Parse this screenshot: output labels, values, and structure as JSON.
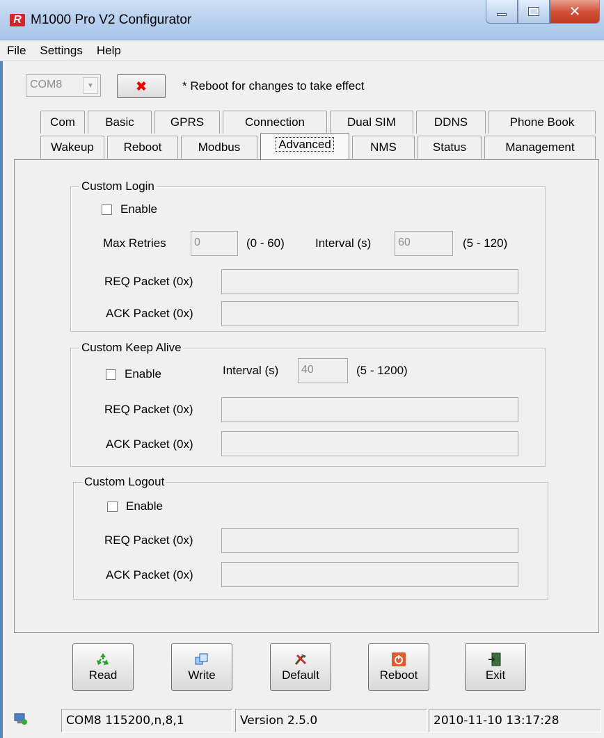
{
  "window": {
    "title": "M1000 Pro V2 Configurator",
    "icon_letter": "R"
  },
  "menu": [
    "File",
    "Settings",
    "Help"
  ],
  "toolbar": {
    "com_port": "COM8",
    "close_symbol": "✖",
    "note": "* Reboot for changes to take effect"
  },
  "tabs_row1": [
    "Com",
    "Basic",
    "GPRS",
    "Connection",
    "Dual SIM",
    "DDNS",
    "Phone Book"
  ],
  "tabs_row2": [
    "Wakeup",
    "Reboot",
    "Modbus",
    "Advanced",
    "NMS",
    "Status",
    "Management"
  ],
  "active_tab": "Advanced",
  "custom_login": {
    "title": "Custom Login",
    "enable_label": "Enable",
    "enabled": false,
    "max_retries_label": "Max Retries",
    "max_retries_value": "0",
    "max_retries_range": "(0 - 60)",
    "interval_label": "Interval (s)",
    "interval_value": "60",
    "interval_range": "(5 - 120)",
    "req_label": "REQ Packet (0x)",
    "req_value": "",
    "ack_label": "ACK Packet (0x)",
    "ack_value": ""
  },
  "custom_keepalive": {
    "title": "Custom Keep Alive",
    "enable_label": "Enable",
    "enabled": false,
    "interval_label": "Interval (s)",
    "interval_value": "40",
    "interval_range": "(5 - 1200)",
    "req_label": "REQ Packet (0x)",
    "req_value": "",
    "ack_label": "ACK Packet (0x)",
    "ack_value": ""
  },
  "custom_logout": {
    "title": "Custom Logout",
    "enable_label": "Enable",
    "enabled": false,
    "req_label": "REQ Packet (0x)",
    "req_value": "",
    "ack_label": "ACK Packet (0x)",
    "ack_value": ""
  },
  "buttons": {
    "read": "Read",
    "write": "Write",
    "default": "Default",
    "reboot": "Reboot",
    "exit": "Exit"
  },
  "status": {
    "port_settings": "COM8 115200,n,8,1",
    "version": "Version 2.5.0",
    "datetime": "2010-11-10 13:17:28"
  },
  "colors": {
    "close_red": "#e00000",
    "title_blue": "#b9d1ee"
  }
}
